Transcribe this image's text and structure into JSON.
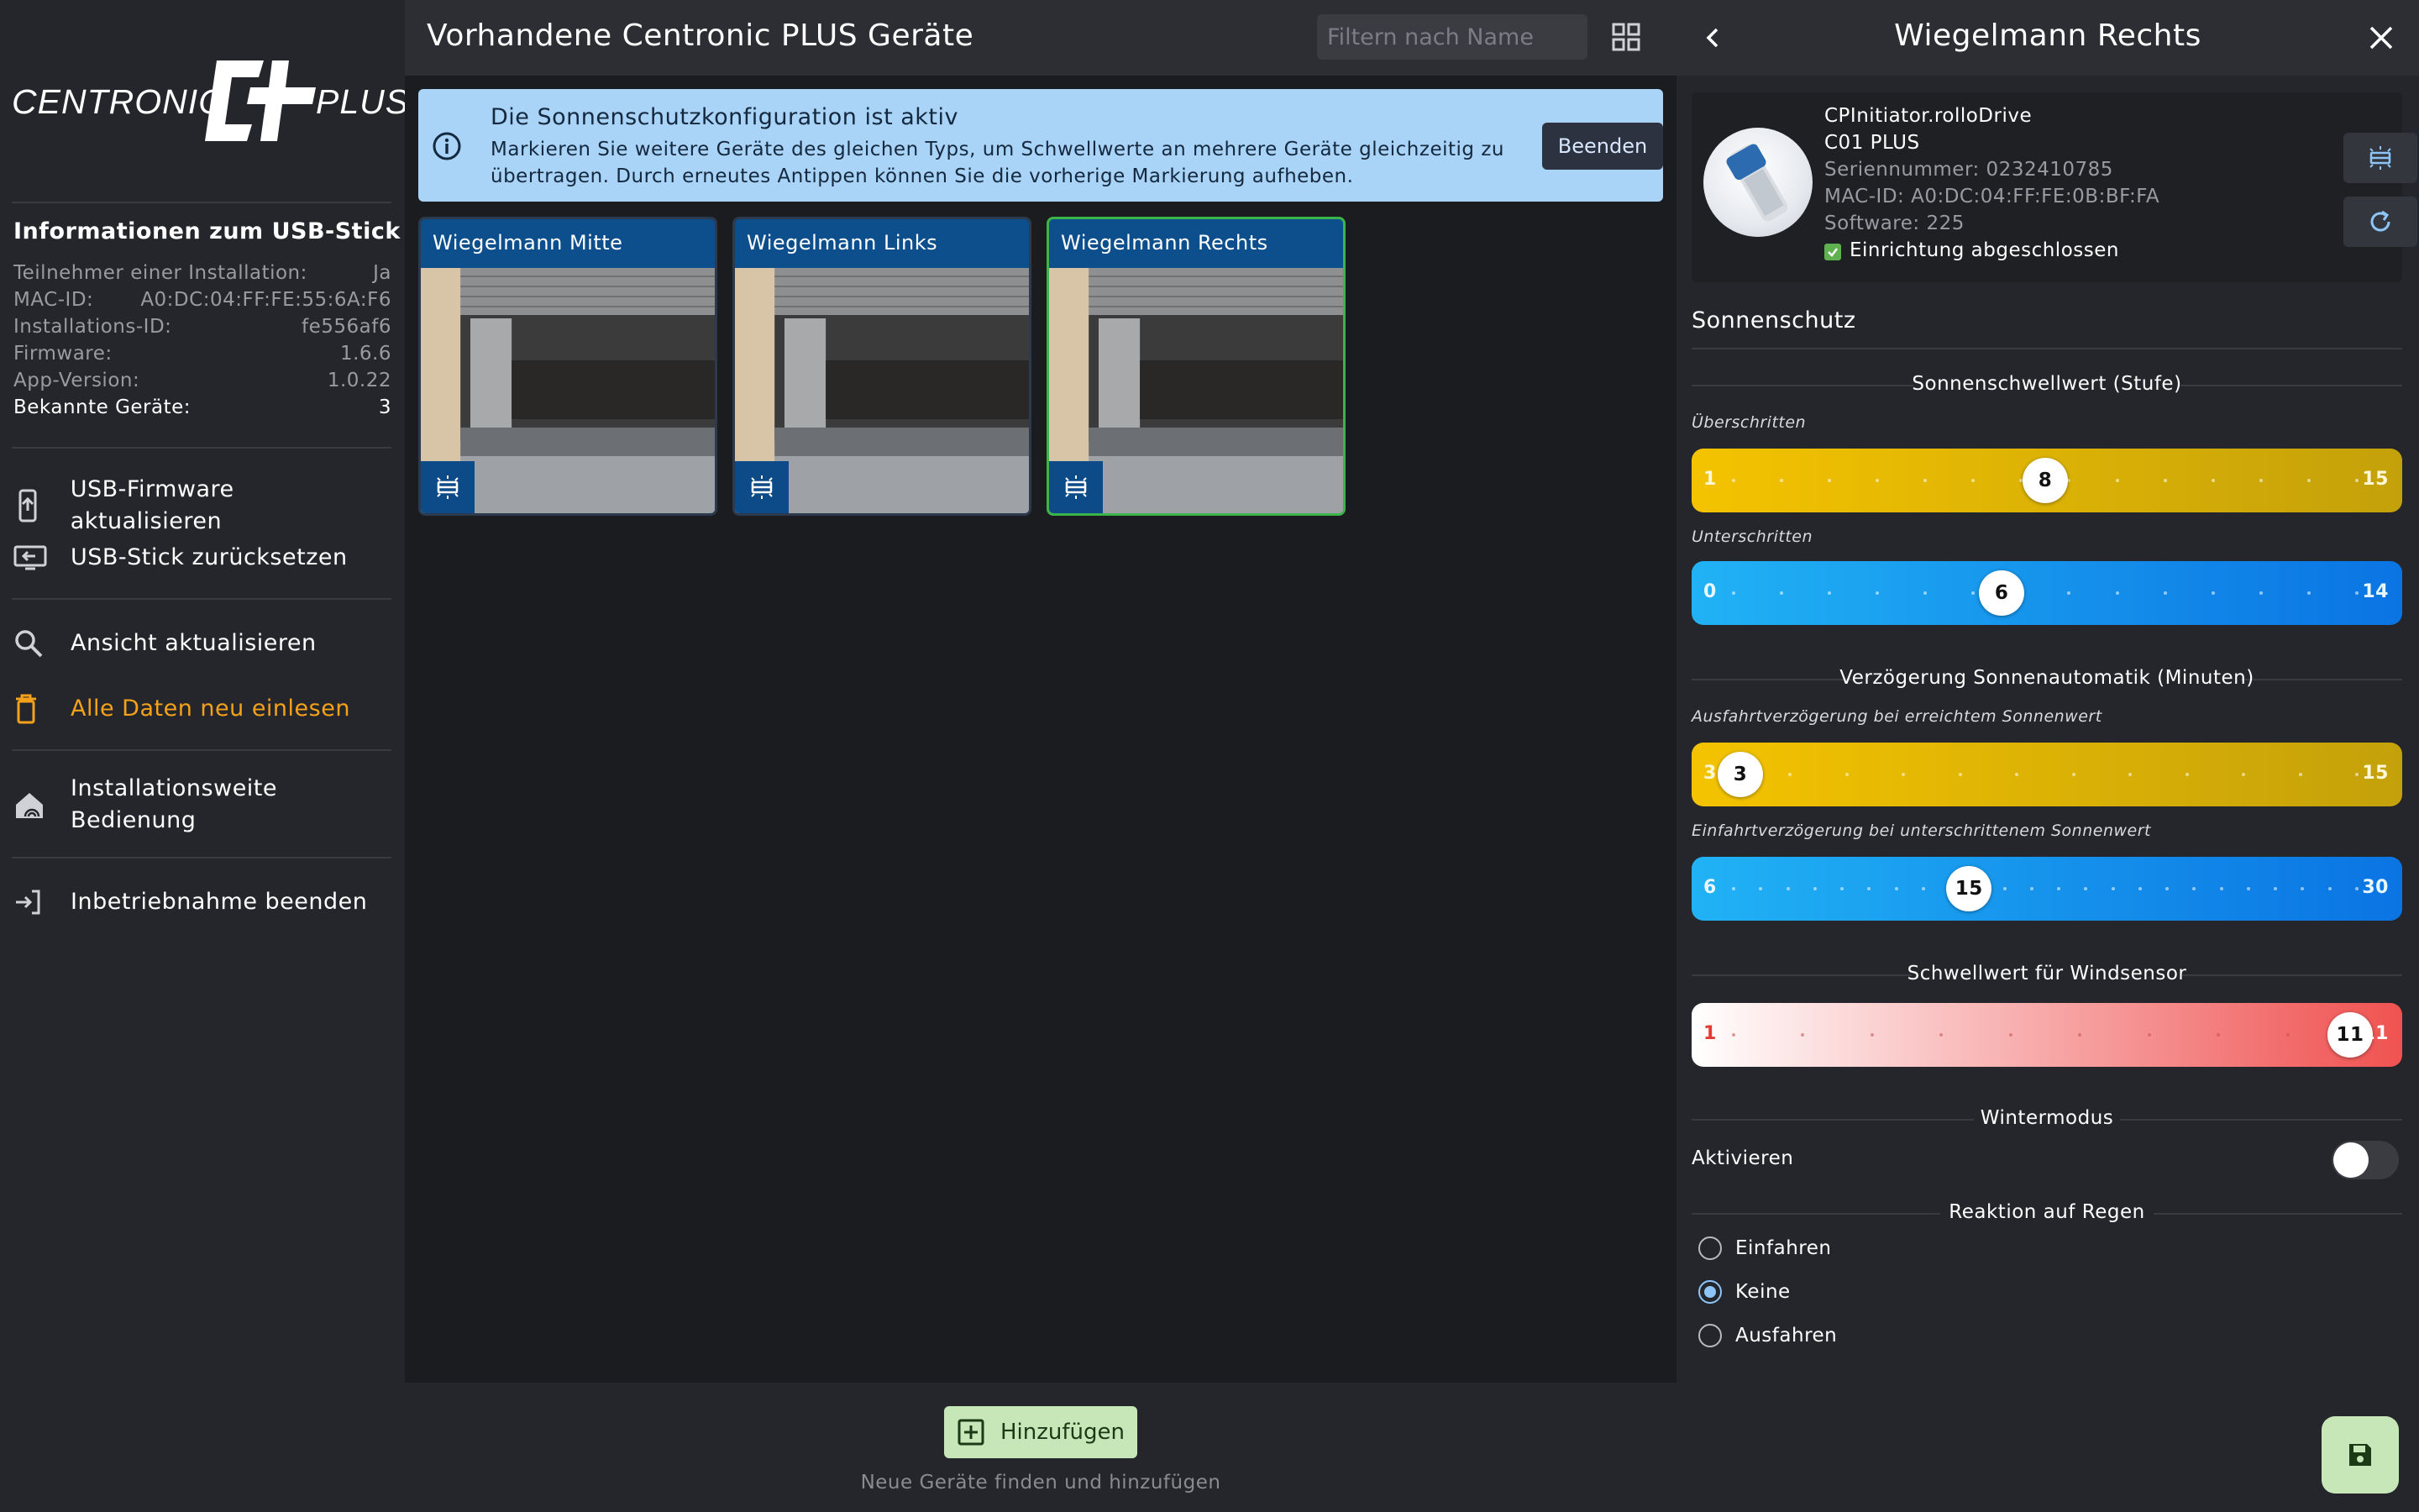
{
  "sidebar": {
    "logo": {
      "left_word": "CENTRONIC",
      "right_word": "PLUS"
    },
    "usb_title": "Informationen zum USB-Stick",
    "info": [
      {
        "label": "Teilnehmer einer Installation:",
        "value": "Ja"
      },
      {
        "label": "MAC-ID:",
        "value": "A0:DC:04:FF:FE:55:6A:F6"
      },
      {
        "label": "Installations-ID:",
        "value": "fe556af6"
      },
      {
        "label": "Firmware:",
        "value": "1.6.6"
      },
      {
        "label": "App-Version:",
        "value": "1.0.22"
      },
      {
        "label": "Bekannte Geräte:",
        "value": "3"
      }
    ],
    "menu": [
      {
        "label": "USB-Firmware aktualisieren",
        "icon": "firmware-upload-icon"
      },
      {
        "label": "USB-Stick zurücksetzen",
        "icon": "usb-reset-icon"
      },
      {
        "label": "Ansicht aktualisieren",
        "icon": "search-icon"
      },
      {
        "label": "Alle Daten neu einlesen",
        "icon": "trash-icon"
      },
      {
        "label": "Installationsweite Bedienung",
        "icon": "house-signal-icon"
      },
      {
        "label": "Inbetriebnahme beenden",
        "icon": "exit-icon"
      }
    ]
  },
  "main": {
    "title": "Vorhandene Centronic PLUS Geräte",
    "filter_placeholder": "Filtern nach Name",
    "banner": {
      "title": "Die Sonnenschutzkonfiguration ist aktiv",
      "text": "Markieren Sie weitere Geräte des gleichen Typs, um Schwellwerte an mehrere Geräte gleichzeitig zu übertragen. Durch erneutes Antippen können Sie die vorherige Markierung aufheben.",
      "button": "Beenden"
    },
    "devices": [
      {
        "name": "Wiegelmann Mitte",
        "selected": false
      },
      {
        "name": "Wiegelmann Links",
        "selected": false
      },
      {
        "name": "Wiegelmann Rechts",
        "selected": true
      }
    ],
    "add_button": "Hinzufügen",
    "add_hint": "Neue Geräte finden und hinzufügen"
  },
  "panel": {
    "title": "Wiegelmann Rechts",
    "device": {
      "type": "CPInitiator.rolloDrive",
      "model": "C01 PLUS",
      "serial": "Seriennummer: 0232410785",
      "mac": "MAC-ID: A0:DC:04:FF:FE:0B:BF:FA",
      "software": "Software: 225",
      "setup": "Einrichtung abgeschlossen"
    },
    "section": "Sonnenschutz",
    "sun_threshold": {
      "heading": "Sonnenschwellwert (Stufe)",
      "exceeded": {
        "label": "Überschritten",
        "min": 1,
        "max": 15,
        "value": 8
      },
      "below": {
        "label": "Unterschritten",
        "min": 0,
        "max": 14,
        "value": 6
      }
    },
    "delay": {
      "heading": "Verzögerung Sonnenautomatik (Minuten)",
      "extend": {
        "label": "Ausfahrtverzögerung bei erreichtem Sonnenwert",
        "min": 3,
        "max": 15,
        "value": 3
      },
      "retract": {
        "label": "Einfahrtverzögerung bei unterschrittenem Sonnenwert",
        "min": 6,
        "max": 30,
        "value": 15
      }
    },
    "wind": {
      "heading": "Schwellwert für Windsensor",
      "min": 1,
      "max": 11,
      "value": 11
    },
    "winter": {
      "heading": "Wintermodus",
      "label": "Aktivieren",
      "enabled": false
    },
    "rain": {
      "heading": "Reaktion auf Regen",
      "options": [
        "Einfahren",
        "Keine",
        "Ausfahren"
      ],
      "selected": "Keine"
    }
  },
  "colors": {
    "accent_green": "#3bb44a",
    "orange": "#f5a21b",
    "banner_blue": "#a9d3f7"
  }
}
